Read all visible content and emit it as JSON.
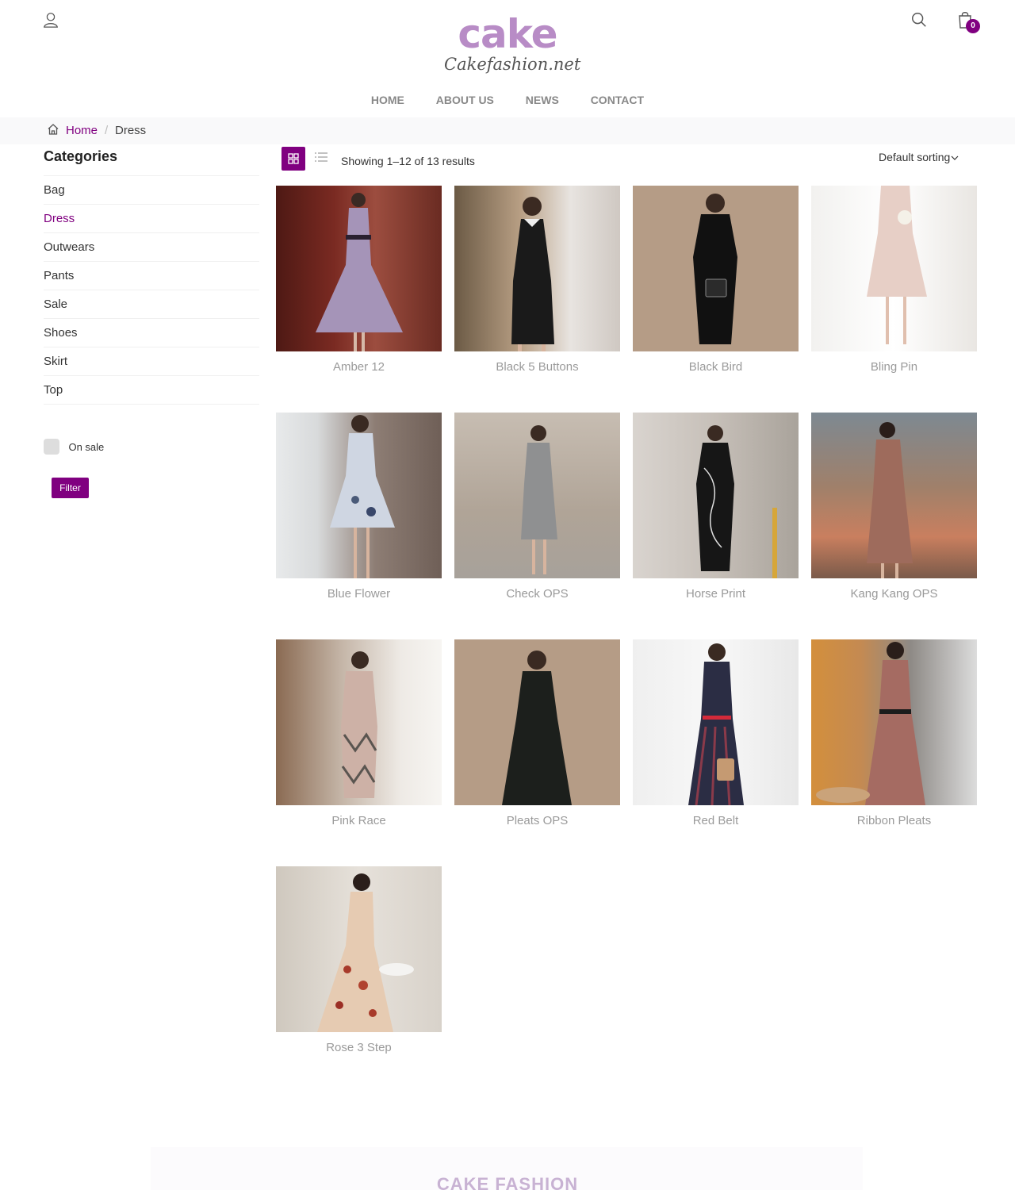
{
  "header": {
    "logo_main": "cake",
    "logo_sub": "Cakefashion.net",
    "cart_count": "0",
    "icons": [
      "user-icon",
      "search-icon",
      "cart-icon"
    ]
  },
  "nav": {
    "items": [
      {
        "label": "HOME"
      },
      {
        "label": "ABOUT US"
      },
      {
        "label": "NEWS"
      },
      {
        "label": "CONTACT"
      }
    ]
  },
  "breadcrumb": {
    "home": "Home",
    "separator": "/",
    "current": "Dress"
  },
  "sidebar": {
    "title": "Categories",
    "items": [
      {
        "label": "Bag"
      },
      {
        "label": "Dress"
      },
      {
        "label": "Outwears"
      },
      {
        "label": "Pants"
      },
      {
        "label": "Sale"
      },
      {
        "label": "Shoes"
      },
      {
        "label": "Skirt"
      },
      {
        "label": "Top"
      }
    ],
    "active": "Dress",
    "on_sale_label": "On sale",
    "filter_label": "Filter"
  },
  "toolbar": {
    "results_text": "Showing 1–12 of 13 results",
    "sorting": "Default sorting"
  },
  "products": [
    {
      "name": "Amber 12"
    },
    {
      "name": "Black 5 Buttons"
    },
    {
      "name": "Black Bird"
    },
    {
      "name": "Bling Pin"
    },
    {
      "name": "Blue Flower"
    },
    {
      "name": "Check OPS"
    },
    {
      "name": "Horse Print"
    },
    {
      "name": "Kang Kang OPS"
    },
    {
      "name": "Pink Race"
    },
    {
      "name": "Pleats OPS"
    },
    {
      "name": "Red Belt"
    },
    {
      "name": "Ribbon Pleats"
    },
    {
      "name": "Rose 3 Step"
    }
  ],
  "footer": {
    "title": "CAKE FASHION"
  },
  "colors": {
    "accent": "#800080",
    "logo": "#b88cc6"
  }
}
